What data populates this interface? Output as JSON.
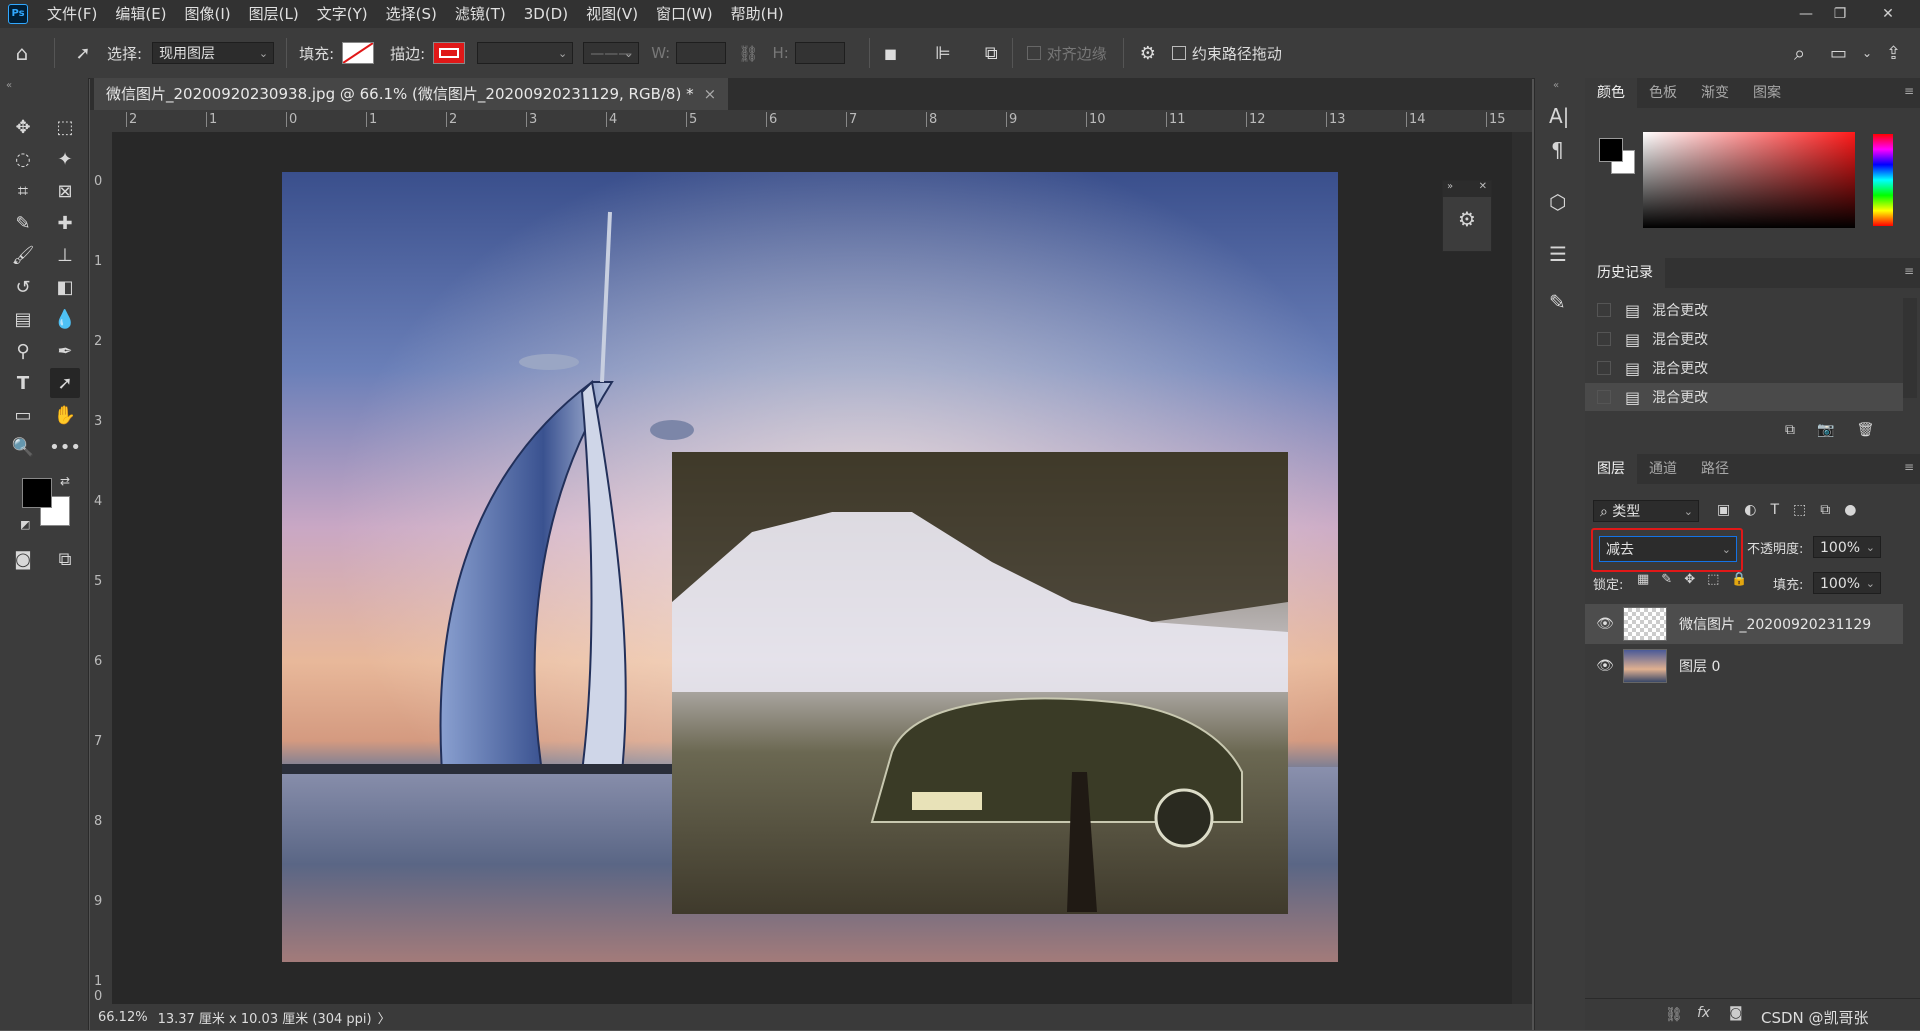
{
  "app": {
    "logo": "Ps"
  },
  "menu": [
    "文件(F)",
    "编辑(E)",
    "图像(I)",
    "图层(L)",
    "文字(Y)",
    "选择(S)",
    "滤镜(T)",
    "3D(D)",
    "视图(V)",
    "窗口(W)",
    "帮助(H)"
  ],
  "options": {
    "select_label": "选择:",
    "select_value": "现用图层",
    "fill_label": "填充:",
    "stroke_label": "描边:",
    "w_label": "W:",
    "h_label": "H:",
    "align_edges": "对齐边缘",
    "constrain_path": "约束路径拖动"
  },
  "document": {
    "tab_title": "微信图片_20200920230938.jpg @ 66.1% (微信图片_20200920231129, RGB/8) *",
    "close": "×"
  },
  "ruler": {
    "h_labels": [
      "2",
      "1",
      "0",
      "1",
      "2",
      "3",
      "4",
      "5",
      "6",
      "7",
      "8",
      "9",
      "10",
      "11",
      "12",
      "13",
      "14",
      "15"
    ],
    "v_labels": [
      "0",
      "1",
      "2",
      "3",
      "4",
      "5",
      "6",
      "7",
      "8",
      "9",
      "1 0"
    ]
  },
  "status": {
    "zoom": "66.12%",
    "size": "13.37 厘米 x 10.03 厘米 (304 ppi)",
    "arrow": "〉"
  },
  "color_panel": {
    "tabs": [
      "颜色",
      "色板",
      "渐变",
      "图案"
    ],
    "fg": "#000000",
    "bg": "#ffffff"
  },
  "history_panel": {
    "title": "历史记录",
    "items": [
      "混合更改",
      "混合更改",
      "混合更改",
      "混合更改"
    ]
  },
  "layers_panel": {
    "tabs": [
      "图层",
      "通道",
      "路径"
    ],
    "filter_label": "类型",
    "blend_mode": "减去",
    "opacity_label": "不透明度:",
    "opacity_value": "100%",
    "lock_label": "锁定:",
    "fill_label": "填充:",
    "fill_value": "100%",
    "layers": [
      {
        "name": "微信图片 _20200920231129",
        "visible": true,
        "selected": true
      },
      {
        "name": "图层 0",
        "visible": true,
        "selected": false
      }
    ]
  },
  "watermark": "CSDN @凯哥张",
  "colors": {
    "highlight": "#e01818",
    "accent": "#1473e6"
  }
}
